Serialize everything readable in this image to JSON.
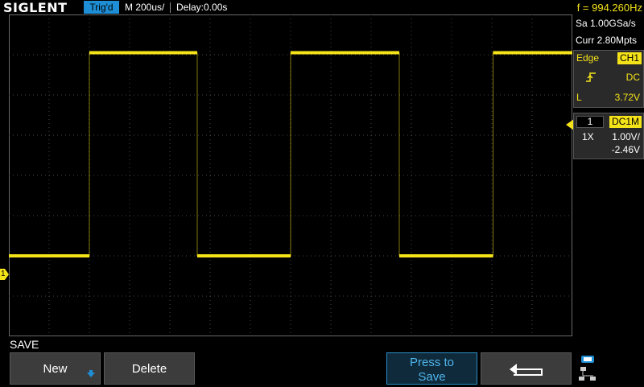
{
  "header": {
    "brand": "SIGLENT",
    "trig_status": "Trig'd",
    "timebase": "M 200us/",
    "delay": "Delay:0.00s",
    "frequency": "f = 994.260Hz"
  },
  "acquisition": {
    "sample_rate": "Sa 1.00GSa/s",
    "memory_depth": "Curr 2.80Mpts"
  },
  "trigger": {
    "type": "Edge",
    "source": "CH1",
    "coupling": "DC",
    "level_label": "L",
    "level": "3.72V"
  },
  "channel1": {
    "number": "1",
    "coupling": "DC1M",
    "probe": "1X",
    "scale": "1.00V/",
    "offset": "-2.46V",
    "ground_marker": "1"
  },
  "menu": {
    "title": "SAVE",
    "softkeys": [
      {
        "label": "New"
      },
      {
        "label": "Delete"
      },
      {
        "label": "Press to"
      },
      {
        "label": "Save"
      }
    ]
  },
  "colors": {
    "channel1": "#f5e31a",
    "accent": "#1e8fd6"
  },
  "chart_data": {
    "type": "line",
    "x_divisions": 14,
    "y_divisions": 8,
    "series": [
      {
        "x_div": [
          0.0,
          2.0,
          2.0,
          4.68,
          4.68,
          7.0,
          7.0,
          9.7,
          9.7,
          12.03,
          12.03,
          14.0
        ],
        "y_div": [
          -2.0,
          -2.0,
          3.05,
          3.05,
          -2.0,
          -2.0,
          3.05,
          3.05,
          -2.0,
          -2.0,
          3.05,
          3.05
        ]
      }
    ]
  }
}
